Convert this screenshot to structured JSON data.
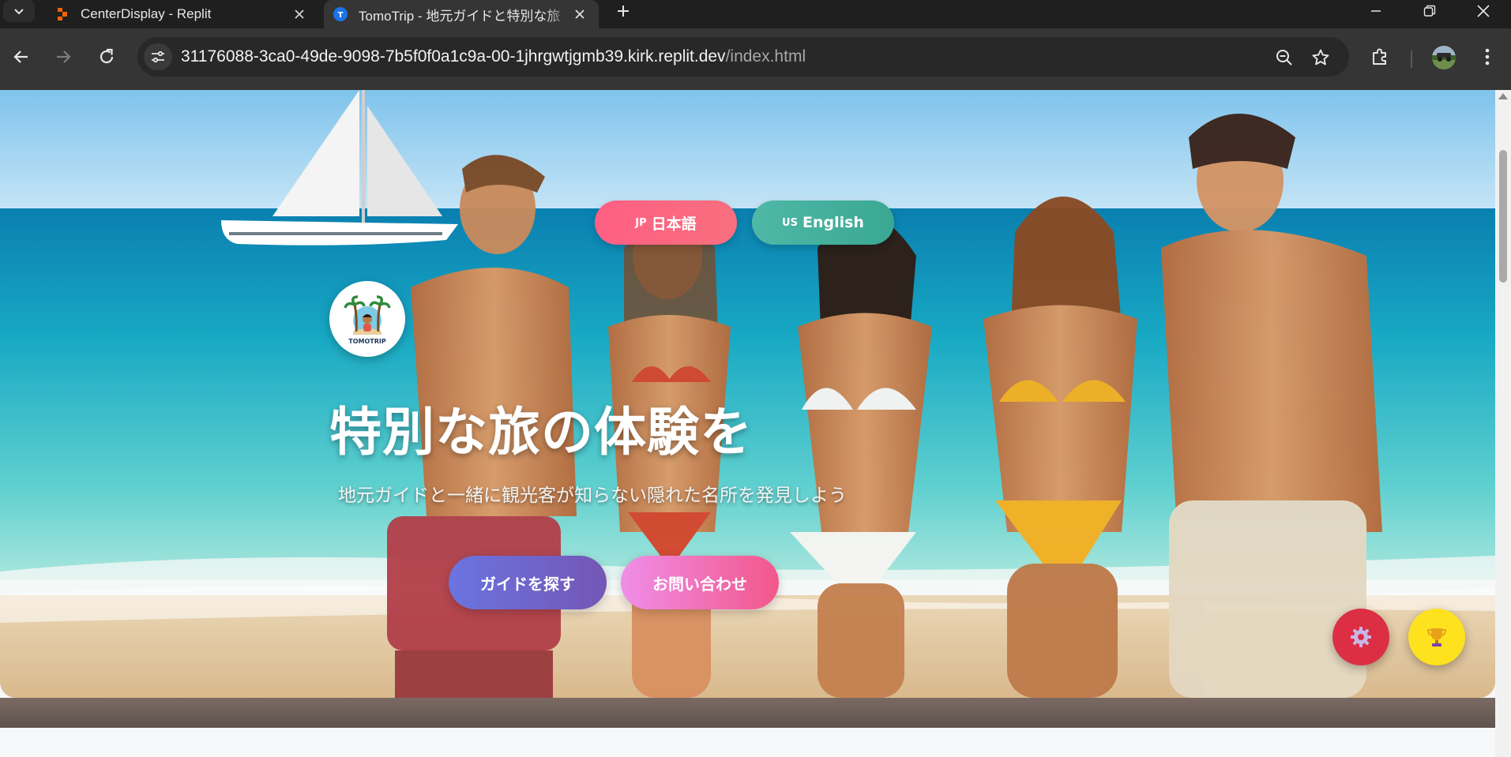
{
  "browser": {
    "tabs": [
      {
        "title": "CenterDisplay - Replit",
        "active": false
      },
      {
        "title": "TomoTrip - 地元ガイドと特別な旅",
        "active": true
      }
    ],
    "url_host": "31176088-3ca0-49de-9098-7b5f0f0a1c9a-00-1jhrgwtjgmb39.kirk.replit.dev",
    "url_path": "/index.html"
  },
  "page": {
    "language_buttons": [
      {
        "code": "JP",
        "label": "日本語",
        "color": "#ff5f83"
      },
      {
        "code": "US",
        "label": "English",
        "color": "#4fb8a6"
      }
    ],
    "logo_text": "TOMOTRIP",
    "hero": {
      "title": "特別な旅の体験を",
      "subtitle": "地元ガイドと一緒に観光客が知らない隠れた名所を発見しよう"
    },
    "cta": {
      "find_guide": "ガイドを探す",
      "contact": "お問い合わせ"
    },
    "fabs": [
      {
        "icon": "gear-icon",
        "color": "#dc2f44"
      },
      {
        "icon": "trophy-icon",
        "color": "#ffe21e"
      }
    ]
  }
}
